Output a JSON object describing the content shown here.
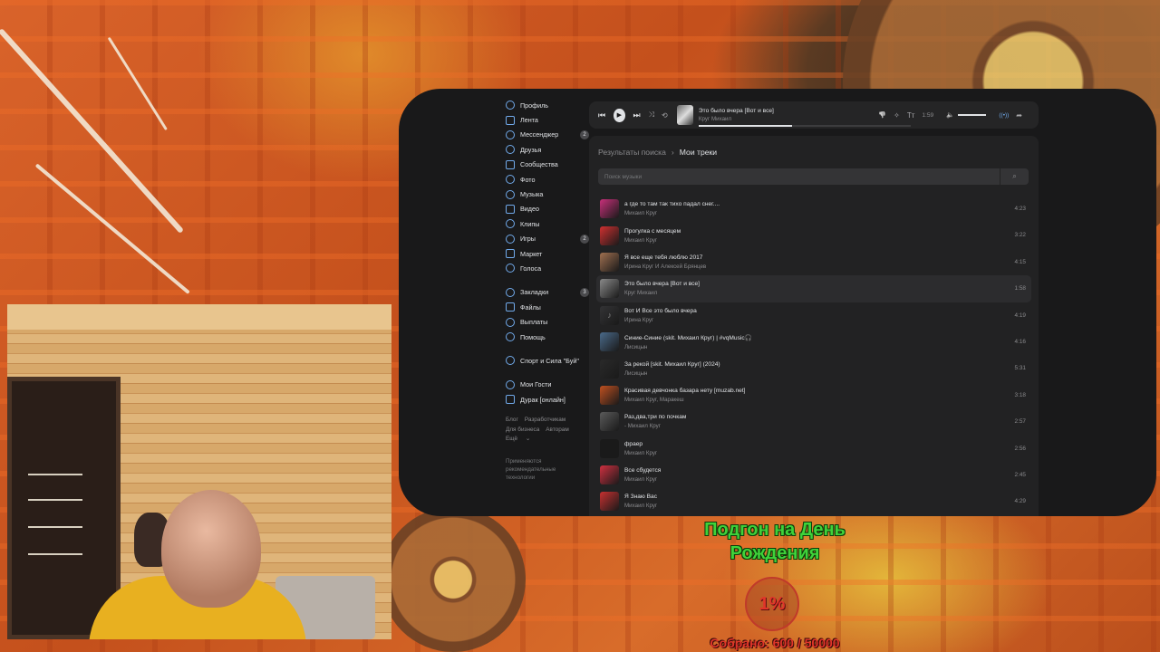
{
  "sidebar": {
    "items": [
      {
        "label": "Профиль",
        "icon": "profile-icon"
      },
      {
        "label": "Лента",
        "icon": "news-icon"
      },
      {
        "label": "Мессенджер",
        "icon": "messenger-icon",
        "badge": "2"
      },
      {
        "label": "Друзья",
        "icon": "friends-icon"
      },
      {
        "label": "Сообщества",
        "icon": "communities-icon"
      },
      {
        "label": "Фото",
        "icon": "photo-icon"
      },
      {
        "label": "Музыка",
        "icon": "music-icon"
      },
      {
        "label": "Видео",
        "icon": "video-icon"
      },
      {
        "label": "Клипы",
        "icon": "clips-icon"
      },
      {
        "label": "Игры",
        "icon": "games-icon",
        "badge": "2"
      },
      {
        "label": "Маркет",
        "icon": "market-icon"
      },
      {
        "label": "Голоса",
        "icon": "votes-icon"
      }
    ],
    "items2": [
      {
        "label": "Закладки",
        "icon": "bookmarks-icon",
        "badge": "3"
      },
      {
        "label": "Файлы",
        "icon": "files-icon"
      },
      {
        "label": "Выплаты",
        "icon": "payouts-icon"
      },
      {
        "label": "Помощь",
        "icon": "help-icon"
      }
    ],
    "items3": [
      {
        "label": "Спорт и Сила \"Буй\"",
        "icon": "group-icon"
      }
    ],
    "items4": [
      {
        "label": "Мои Гости",
        "icon": "app-icon"
      },
      {
        "label": "Дурак [онлайн]",
        "icon": "cards-icon"
      }
    ],
    "footer_links": [
      "Блог",
      "Разработчикам",
      "Для бизнеса",
      "Авторам",
      "Ещё"
    ],
    "footer_more_chevron": "⌄",
    "note": "Применяются рекомендательные технологии"
  },
  "player": {
    "prev": "⏮",
    "play": "▶",
    "next": "⏭",
    "shuffle": "⤨",
    "repeat": "⟲",
    "title": "Это было вчера [Вот и все]",
    "artist": "Круг Михаил",
    "progress": 0.44,
    "dislike": "👎",
    "ai": "✧",
    "lyrics": "Tт",
    "time": "1:59",
    "volume_icon": "🔈",
    "volume": 1.0,
    "broadcast": "((•))",
    "share": "➦"
  },
  "content": {
    "crumb_1": "Результаты поиска",
    "crumb_sep": "›",
    "crumb_2": "Мои треки",
    "search_placeholder": "Поиск музыки",
    "search_icon": "⌕"
  },
  "tracks": [
    {
      "title": "а где то там так тихо падал снег....",
      "artist": "Михаил Круг",
      "duration": "4:23",
      "cover": "#c8307a"
    },
    {
      "title": "Прогулка с месяцем",
      "artist": "Михаил Круг",
      "duration": "3:22",
      "cover": "#d03030"
    },
    {
      "title": "Я все еще тебя люблю 2017",
      "artist": "Ирина Круг И Алексей Брянцев",
      "duration": "4:15",
      "cover": "#a07050"
    },
    {
      "title": "Это было вчера [Вот и все]",
      "artist": "Круг Михаил",
      "duration": "1:58",
      "cover": "#8a8a8a",
      "active": true
    },
    {
      "title": "Вот И Все это было вчера",
      "artist": "Ирина Круг",
      "duration": "4:19",
      "cover": "#333335",
      "glyph": "♪"
    },
    {
      "title": "Синие-Синие (skit. Михаил Круг) | #vqMusic🎧",
      "artist": "Лисицын",
      "duration": "4:16",
      "cover": "#4a6a8a"
    },
    {
      "title": "За рекой [skit. Михаил Круг] (2024)",
      "artist": "Лисицын",
      "duration": "5:31",
      "cover": "#2a2a2a"
    },
    {
      "title": "Красивая девчонка базара нету [muzab.net]",
      "artist": "Михаил Круг, Маракеш",
      "duration": "3:18",
      "cover": "#c05020"
    },
    {
      "title": "Раз,два,три по почкам",
      "artist": "- Михаил Круг",
      "duration": "2:57",
      "cover": "#5a5a5a"
    },
    {
      "title": "фраер",
      "artist": "Михаил Круг",
      "duration": "2:56",
      "cover": "#1a1a1a"
    },
    {
      "title": "Все сбудется",
      "artist": "Михаил Круг",
      "duration": "2:45",
      "cover": "#d03040"
    },
    {
      "title": "Я Знаю Вас",
      "artist": "Михаил Круг",
      "duration": "4:29",
      "cover": "#c83030"
    }
  ],
  "donation": {
    "title": "Подгон на День Рождения",
    "percent": "1%",
    "collected": "Собрано: 600 / 50000"
  }
}
